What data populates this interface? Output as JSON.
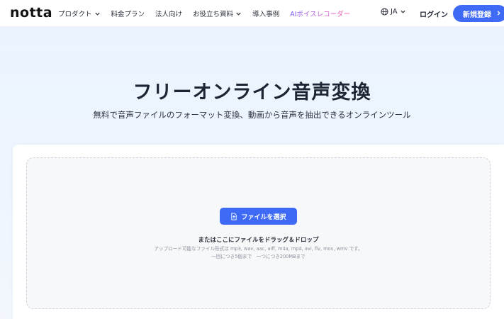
{
  "header": {
    "logo": "notta",
    "nav": [
      {
        "label": "プロダクト",
        "dropdown": true
      },
      {
        "label": "料金プラン",
        "dropdown": false
      },
      {
        "label": "法人向け",
        "dropdown": false
      },
      {
        "label": "お役立ち資料",
        "dropdown": true
      },
      {
        "label": "導入事例",
        "dropdown": false
      },
      {
        "label": "AIボイスレコーダー",
        "dropdown": false
      }
    ],
    "language": "JA",
    "login_label": "ログイン",
    "signup_label": "新規登録",
    "signup_color": "#3f6af5",
    "ai_link_gradient": [
      "#7b5cff",
      "#ff5ca8"
    ]
  },
  "hero": {
    "title": "フリーオンライン音声変換",
    "subtitle": "無料で音声ファイルのフォーマット変換、動画から音声を抽出できるオンラインツール"
  },
  "upload": {
    "button_label": "ファイルを選択",
    "button_icon": "file-upload-icon",
    "drop_text": "またはここにファイルをドラッグ＆ドロップ",
    "formats_text": "アップロード可能なファイル形式は mp3, wav, aac, aiff, m4a, mp4, avi, flv, mov, wmv です。",
    "limits_text": "一回につき5個まで　一つにつき200MBまで"
  }
}
